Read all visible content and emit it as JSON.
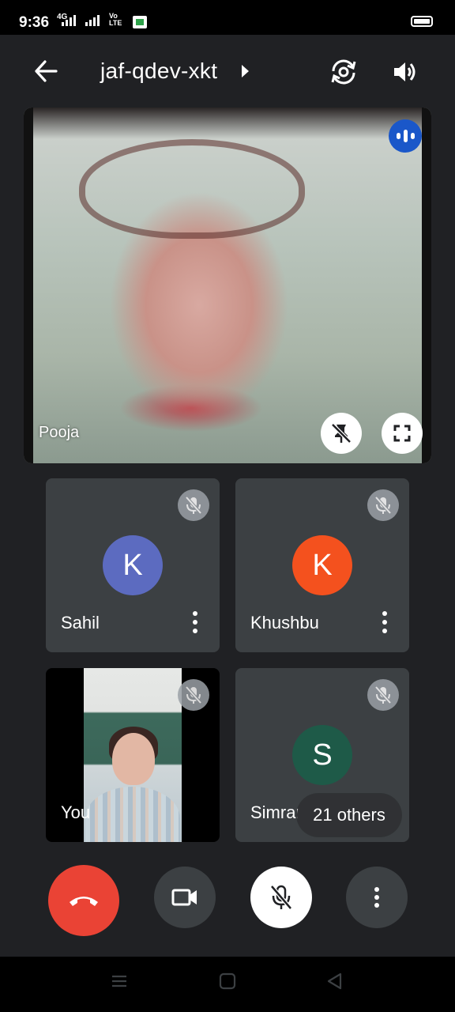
{
  "status_bar": {
    "time": "9:36",
    "network_badge": "4G",
    "volte_label": "Vo\nLTE",
    "icons": [
      "signal-icon",
      "signal-icon",
      "app-notification-icon",
      "battery-icon"
    ]
  },
  "header": {
    "meeting_code": "jaf-qdev-xkt",
    "icons": [
      "back-arrow-icon",
      "meeting-info-caret-icon",
      "switch-camera-icon",
      "speaker-icon"
    ]
  },
  "main_tile": {
    "participant_name": "Pooja",
    "speaking": true,
    "icons": [
      "speaking-indicator-icon",
      "unpin-icon",
      "fullscreen-icon"
    ]
  },
  "participant_tiles": [
    {
      "name": "Sahil",
      "initial": "K",
      "avatar_color": "#5c6bc0",
      "muted": true,
      "has_menu": true
    },
    {
      "name": "Khushbu",
      "initial": "K",
      "avatar_color": "#f4511e",
      "muted": true,
      "has_menu": true
    },
    {
      "name": "You",
      "video_on": true,
      "muted": true
    },
    {
      "name": "Simranj",
      "initial": "S",
      "avatar_color": "#1e5a48",
      "muted": true
    }
  ],
  "others_label": "21 others",
  "controls": {
    "end_call_color": "#ea4335",
    "icons": [
      "end-call-icon",
      "camera-icon",
      "mic-off-icon",
      "more-options-icon"
    ]
  },
  "nav_bar": {
    "icons": [
      "recents-icon",
      "home-icon",
      "back-icon"
    ]
  }
}
